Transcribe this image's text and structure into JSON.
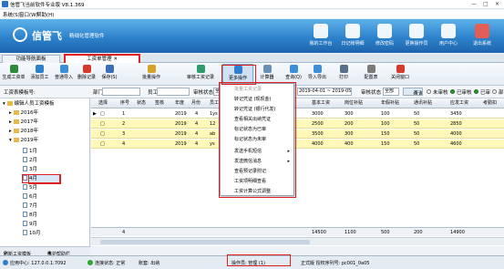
{
  "window": {
    "title": "信管飞当前软件专业版 V8.1.369",
    "controls": [
      "—",
      "□",
      "✕"
    ]
  },
  "menu": [
    "系统(S)",
    "窗口(W)",
    "帮助(H)"
  ],
  "banner": {
    "brand": "信管飞",
    "slogan": "精细化管理软件",
    "buttons": [
      {
        "label": "我的工作台",
        "icon": "workbench-icon"
      },
      {
        "label": "日记帐明细",
        "icon": "journal-icon"
      },
      {
        "label": "修改密码",
        "icon": "key-icon"
      },
      {
        "label": "更换操作员",
        "icon": "switch-user-icon"
      },
      {
        "label": "用户中心",
        "icon": "user-center-icon"
      },
      {
        "label": "退出系统",
        "icon": "power-icon"
      }
    ]
  },
  "tabs": [
    {
      "label": "功能导航面板",
      "active": false
    },
    {
      "label": "工资单管理",
      "active": true
    }
  ],
  "toolbar": [
    {
      "label": "生成工资单",
      "color": "#2f8a3a"
    },
    {
      "label": "添加员工",
      "color": "#2f7fcf"
    },
    {
      "label": "普通导入",
      "color": "#3a8fd8"
    },
    {
      "label": "删除记录",
      "color": "#d83a2a"
    },
    {
      "label": "保存(S)",
      "color": "#3a6fb8"
    },
    {
      "label": "批量操作",
      "color": "#d8a22a"
    },
    {
      "label": "审核工资记录",
      "color": "#2f9a6a"
    },
    {
      "label": "更多操作",
      "color": "#2f7fcf"
    },
    {
      "label": "计算器",
      "color": "#6a8fb5"
    },
    {
      "label": "查询(Q)",
      "color": "#3a8fd8"
    },
    {
      "label": "导入导出",
      "color": "#3a8fd8"
    },
    {
      "label": "打印",
      "color": "#5a6f88"
    },
    {
      "label": "配置表",
      "color": "#7a7a7a"
    },
    {
      "label": "关闭窗口",
      "color": "#d83a2a"
    }
  ],
  "filter": {
    "label_month": "工资表模板号:",
    "dept_label": "部门",
    "dept_value": "",
    "employee_label": "员工",
    "status_label": "审核状态",
    "status_value": "全部",
    "date_range": "2019-04-01 ~ 2019-05-31",
    "audit_label": "审核状态",
    "audit_value": "全部",
    "search_label": "查询",
    "radios": [
      {
        "label": "未审核",
        "selected": false
      },
      {
        "label": "已审核",
        "selected": true
      },
      {
        "label": "已审"
      },
      {
        "label": "部"
      }
    ]
  },
  "tree": {
    "root": "编辑人员工资模板",
    "nodes": [
      "2016年",
      "2017年",
      "2018年",
      "2019年"
    ],
    "months": [
      "1月",
      "2月",
      "3月",
      "4月",
      "5月",
      "6月",
      "7月",
      "8月",
      "9月",
      "10月"
    ],
    "selected_month": "4月",
    "bottom": [
      "刷新工资模板",
      "维护帮助栏"
    ]
  },
  "grid": {
    "columns": [
      "选择",
      "序号",
      "状态",
      "签核",
      "年度",
      "月份",
      "员工",
      "基本工资",
      "岗位补贴",
      "年假补贴",
      "通讯补贴",
      "应发工资",
      "考勤扣"
    ],
    "rows": [
      {
        "no": "1",
        "year": "2019",
        "month": "4",
        "emp": "1ys",
        "base": "3000",
        "post": "300",
        "annual": "100",
        "comm": "50",
        "gross": "3450"
      },
      {
        "no": "2",
        "year": "2019",
        "month": "4",
        "emp": "12",
        "base": "2500",
        "post": "200",
        "annual": "100",
        "comm": "50",
        "gross": "2850"
      },
      {
        "no": "3",
        "year": "2019",
        "month": "4",
        "emp": "ab",
        "base": "3500",
        "post": "300",
        "annual": "150",
        "comm": "50",
        "gross": "4000"
      },
      {
        "no": "4",
        "year": "2019",
        "month": "4",
        "emp": "ys",
        "base": "4000",
        "post": "400",
        "annual": "150",
        "comm": "50",
        "gross": "4600"
      }
    ],
    "footer": {
      "count": "4",
      "base": "14500",
      "post": "1100",
      "annual": "500",
      "comm": "200",
      "gross": "14900"
    }
  },
  "popup": {
    "header": "批量工资记录",
    "items": [
      {
        "label": "转记凭证 (现现金)",
        "submenu": false
      },
      {
        "label": "转记凭证 (银行代发)",
        "submenu": false
      },
      {
        "label": "查看相关出纳凭证",
        "submenu": false
      },
      {
        "label": "标记状态为已审",
        "submenu": false
      },
      {
        "label": "标记状态为未审",
        "submenu": false
      },
      {
        "label": "发送手机短信",
        "submenu": true
      },
      {
        "label": "发送微信消息",
        "submenu": true
      },
      {
        "label": "查看预记录附记",
        "submenu": false
      },
      {
        "label": "工资项明细查看",
        "submenu": false
      },
      {
        "label": "工资计算公式调整",
        "submenu": false
      }
    ]
  },
  "status": {
    "server": "应用中心: 127.0.0.1:7092",
    "connection": "连接状态: 正常",
    "account": "账套: 出纳",
    "operator": "操作员: 管理 (1)",
    "license": "正式版 授权序列号: pc001_0a05"
  },
  "colors": {
    "banner": "#2d82cc",
    "row_highlight": "#fff8b8",
    "status_ok": "#2fa82f",
    "alert_box": "#e02020"
  }
}
